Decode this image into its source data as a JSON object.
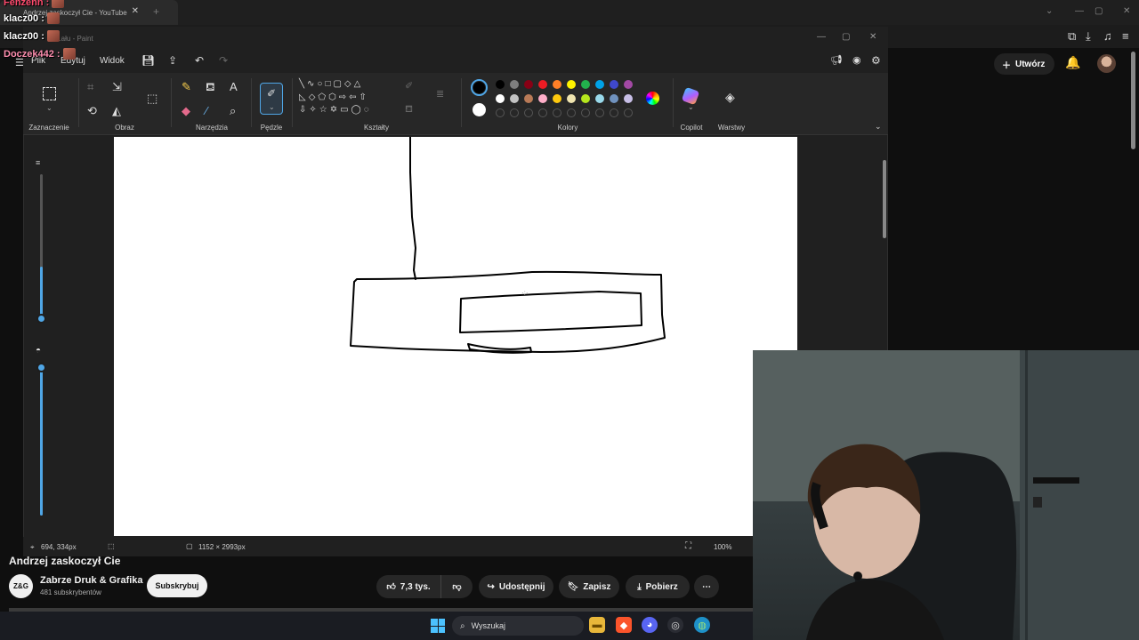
{
  "browser": {
    "tab_title": "Andrzej zaskoczył Cie - YouTube",
    "tab_close": "✕",
    "new_tab": "+"
  },
  "chat": [
    {
      "user": "Fenzenn",
      "sep": ":",
      "color": "#ff4b6e"
    },
    {
      "user": "klacz00",
      "sep": ":",
      "color": "#ffffff"
    },
    {
      "user": "klacz00",
      "sep": ":",
      "color": "#ffffff"
    },
    {
      "user": "Doczek442",
      "sep": ":",
      "color": "#ff8fb0"
    }
  ],
  "paint": {
    "title_fragment": "...ału - Paint",
    "menu": {
      "file": "Plik",
      "edit": "Edytuj",
      "view": "Widok"
    },
    "groups": {
      "selection": "Zaznaczenie",
      "image": "Obraz",
      "tools": "Narzędzia",
      "brushes": "Pędzle",
      "shapes": "Kształty",
      "colors": "Kolory",
      "copilot": "Copilot",
      "layers": "Warstwy"
    },
    "palette_row1": [
      "#000000",
      "#7f7f7f",
      "#880015",
      "#ed1c24",
      "#ff7f27",
      "#fff200",
      "#22b14c",
      "#00a2e8",
      "#3f48cc",
      "#a349a4"
    ],
    "palette_row2": [
      "#ffffff",
      "#c3c3c3",
      "#b97a57",
      "#ffaec9",
      "#ffc90e",
      "#efe4b0",
      "#b5e61d",
      "#99d9ea",
      "#7092be",
      "#c8bfe7"
    ],
    "status": {
      "cursor_pos": "694, 334px",
      "canvas_size": "1152 × 2993px",
      "zoom": "100%"
    }
  },
  "youtube": {
    "create_label": "Utwórz",
    "video_title": "Andrzej zaskoczył Cie",
    "channel_name": "Zabrze Druk & Grafika",
    "channel_avatar_text": "Z&G",
    "subscribers": "481 subskrybentów",
    "subscribe": "Subskrybuj",
    "likes": "7,3 tys.",
    "share": "Udostępnij",
    "save": "Zapisz",
    "download": "Pobierz",
    "more": "⋯"
  },
  "taskbar": {
    "search_placeholder": "Wyszukaj"
  }
}
